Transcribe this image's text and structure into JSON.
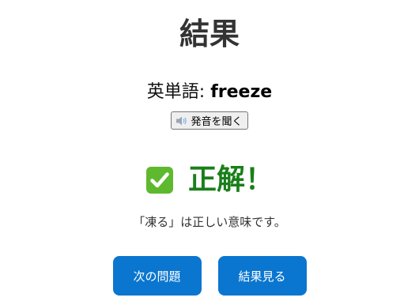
{
  "page": {
    "title": "結果"
  },
  "word": {
    "label": "英単語: ",
    "value": "freeze"
  },
  "speak_button": {
    "label": "発音を聞く",
    "icon": "speaker-icon"
  },
  "result": {
    "icon": "check-mark-icon",
    "text": "正解！",
    "color": "#1a7f1a"
  },
  "explanation": "「凍る」は正しい意味です。",
  "buttons": {
    "next_label": "次の問題",
    "results_label": "結果見る",
    "color": "#0a76cf"
  }
}
